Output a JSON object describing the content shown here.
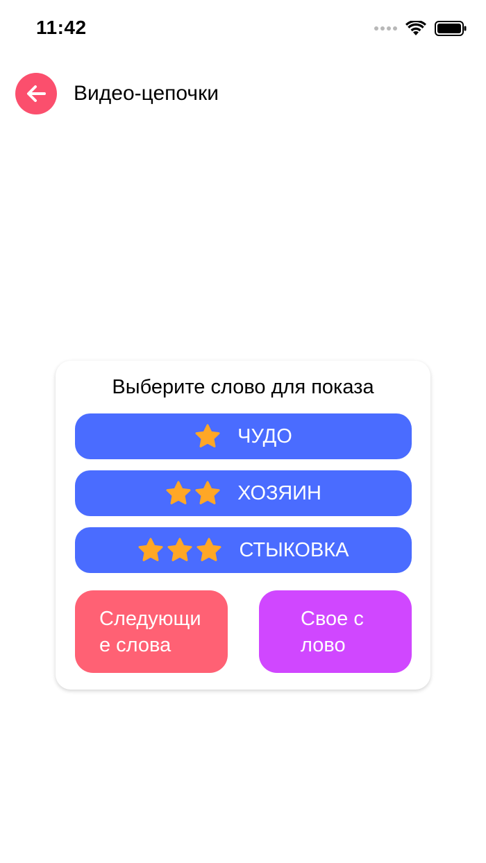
{
  "status_bar": {
    "time": "11:42"
  },
  "header": {
    "title": "Видео-цепочки",
    "back_icon": "arrow-left-icon"
  },
  "card": {
    "title": "Выберите слово для показа",
    "words": [
      {
        "label": "ЧУДО",
        "stars": 1
      },
      {
        "label": "ХОЗЯИН",
        "stars": 2
      },
      {
        "label": "СТЫКОВКА",
        "stars": 3
      }
    ],
    "next_words_label": "Следующие слова",
    "own_word_label": "Свое слово"
  },
  "colors": {
    "back_button": "#FB4F6D",
    "word_button": "#4A6CFF",
    "star": "#FFA726",
    "next_button": "#FF6174",
    "own_button": "#D047FF"
  }
}
